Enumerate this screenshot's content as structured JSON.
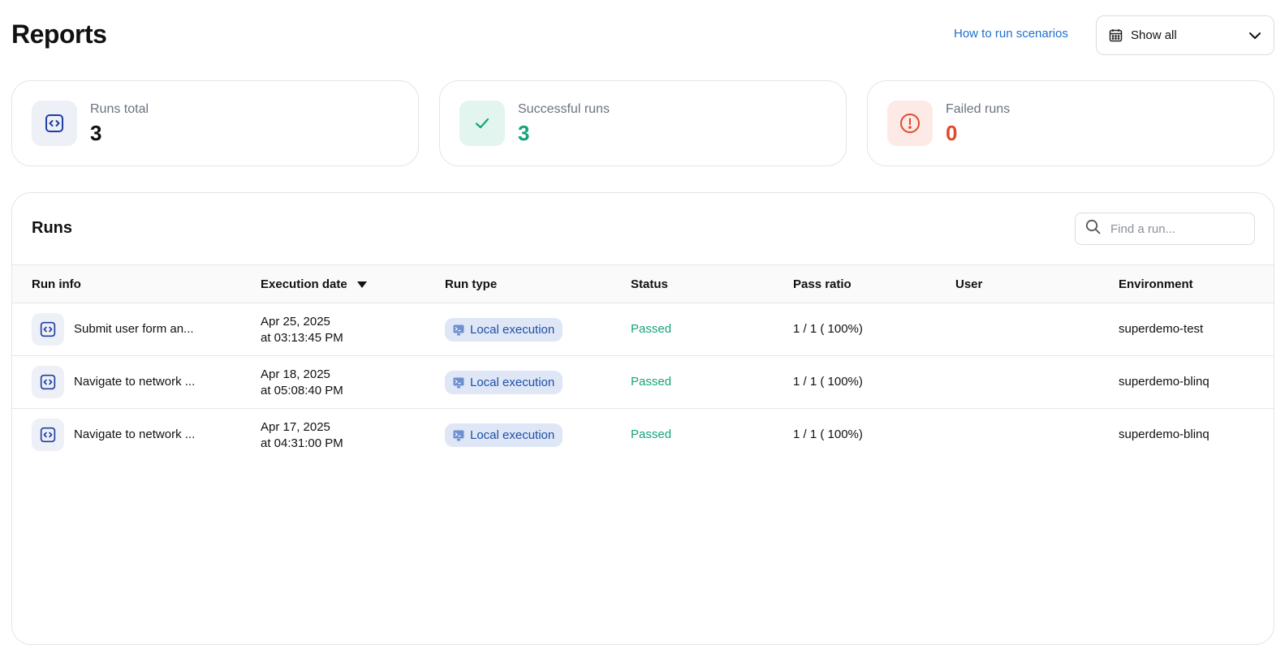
{
  "header": {
    "title": "Reports",
    "help_link": "How to run scenarios",
    "date_filter": {
      "value": "Show all",
      "icon": "calendar-icon"
    }
  },
  "stats": {
    "total": {
      "label": "Runs total",
      "value": "3",
      "icon": "code-icon",
      "color": "#111111"
    },
    "success": {
      "label": "Successful runs",
      "value": "3",
      "icon": "check-icon",
      "color": "#16a37a"
    },
    "failed": {
      "label": "Failed runs",
      "value": "0",
      "icon": "alert-circle-icon",
      "color": "#e0492a"
    }
  },
  "runs": {
    "title": "Runs",
    "search_placeholder": "Find a run...",
    "columns": {
      "run_info": "Run info",
      "execution_date": "Execution date",
      "run_type": "Run type",
      "status": "Status",
      "pass_ratio": "Pass ratio",
      "user": "User",
      "environment": "Environment"
    },
    "sort": {
      "column": "Execution date",
      "direction": "descending"
    },
    "rows": [
      {
        "name": "Submit user form an...",
        "date_line1": "Apr 25, 2025",
        "date_line2": "at 03:13:45 PM",
        "run_type": "Local execution",
        "status": "Passed",
        "pass_ratio": "1 / 1 ( 100%)",
        "user": "",
        "environment": "superdemo-test"
      },
      {
        "name": "Navigate to network ...",
        "date_line1": "Apr 18, 2025",
        "date_line2": "at 05:08:40 PM",
        "run_type": "Local execution",
        "status": "Passed",
        "pass_ratio": "1 / 1 ( 100%)",
        "user": "",
        "environment": "superdemo-blinq"
      },
      {
        "name": "Navigate to network ...",
        "date_line1": "Apr 17, 2025",
        "date_line2": "at 04:31:00 PM",
        "run_type": "Local execution",
        "status": "Passed",
        "pass_ratio": "1 / 1 ( 100%)",
        "user": "",
        "environment": "superdemo-blinq"
      }
    ]
  },
  "colors": {
    "accent_link": "#1f6fd1",
    "success": "#16a37a",
    "danger": "#e0492a",
    "badge_bg": "#dfe7f6",
    "badge_text": "#1e4fa6"
  }
}
